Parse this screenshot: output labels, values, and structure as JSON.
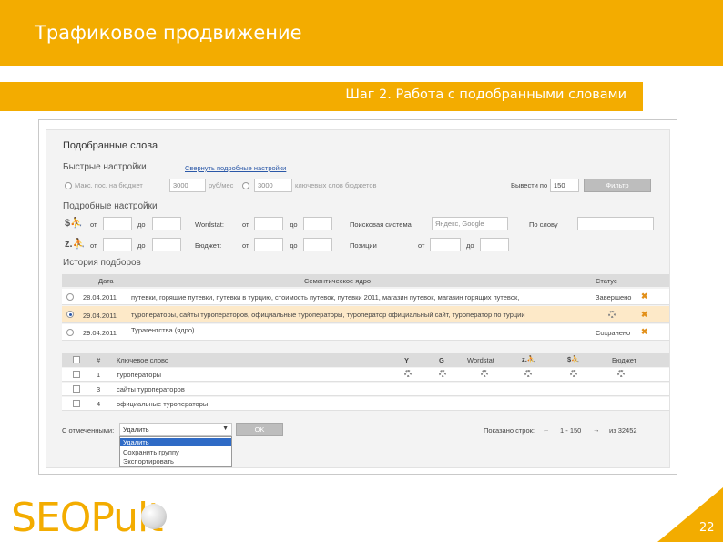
{
  "slide": {
    "title": "Трафиковое продвижение",
    "step": "Шаг 2. Работа с подобранными словами",
    "page_number": "22",
    "logo": "SEOPult"
  },
  "app": {
    "title": "Подобранные слова",
    "quick": {
      "title": "Быстрые настройки",
      "link": "Свернуть подробные настройки",
      "budget_label": "Макс. пос. на бюджет",
      "budget_value": "3000",
      "budget_unit": "руб/мес",
      "count_value": "3000",
      "count_label": "ключевых слов бюджетов",
      "show_label": "Вывести по",
      "show_value": "150",
      "filter_button": "Фильтр"
    },
    "detail": {
      "title": "Подробные настройки",
      "from": "от",
      "to": "до",
      "wordstat": "Wordstat:",
      "budget": "Бюджет:",
      "search_engine_label": "Поисковая система",
      "search_engine_value": "Яндекс, Google",
      "by_word_label": "По слову",
      "positions_label": "Позиции"
    },
    "history": {
      "title": "История подборов",
      "col_date": "Дата",
      "col_core": "Семантическое ядро",
      "col_status": "Статус",
      "rows": [
        {
          "date": "28.04.2011",
          "core": "путевки, горящие путевки, путевки в турцию, стоимость путевок, путевки 2011, магазин путевок, магазин горящих путевок,",
          "status": "Завершено"
        },
        {
          "date": "29.04.2011",
          "core": "туроператоры, сайты туроператоров, официальные туроператоры, туроператор официальный сайт, туроператор по турции",
          "status": ""
        },
        {
          "date": "29.04.2011",
          "core": "Турагентства (ядро)",
          "status": "Сохранено"
        }
      ]
    },
    "keywords": {
      "col_num": "#",
      "col_keyword": "Ключевое слово",
      "col_y": "Y",
      "col_g": "G",
      "col_wordstat": "Wordstat",
      "col_budget": "Бюджет",
      "rows": [
        {
          "num": "1",
          "keyword": "туроператоры"
        },
        {
          "num": "3",
          "keyword": "сайты туроператоров"
        },
        {
          "num": "4",
          "keyword": "официальные туроператоры"
        }
      ]
    },
    "footer": {
      "with_selected": "С отмеченными:",
      "select_value": "Удалить",
      "ok_button": "OK",
      "showing": "Показано строк:",
      "range": "1 - 150",
      "total": "из 32452",
      "options": [
        "Удалить",
        "Сохранить группу",
        "Экспортировать"
      ]
    }
  }
}
